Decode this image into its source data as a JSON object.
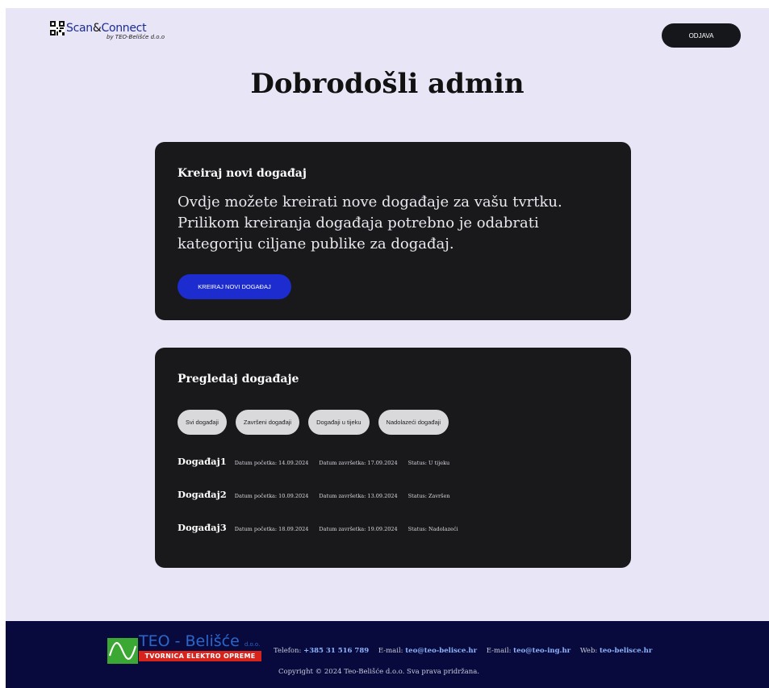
{
  "header": {
    "logo_text": "Scan",
    "logo_amp": "&",
    "logo_text2": "Connect",
    "logo_sub": "by TEO-Belišće d.o.o",
    "logout_label": "ODJAVA"
  },
  "title": "Dobrodošli admin",
  "create_card": {
    "title": "Kreiraj novi događaj",
    "description": "Ovdje možete kreirati nove događaje za vašu tvrtku. Prilikom kreiranja događaja potrebno je odabrati kategoriju ciljane publike za događaj.",
    "button_label": "KREIRAJ NOVI DOGAĐAJ"
  },
  "list_card": {
    "title": "Pregledaj događaje",
    "filters": [
      "Svi događaji",
      "Završeni događaji",
      "Događaji u tijeku",
      "Nadolazeći događaji"
    ],
    "events": [
      {
        "name": "Događaj1",
        "start": "Datum početka: 14.09.2024",
        "end": "Datum završetka: 17.09.2024",
        "status": "Status: U tijeku"
      },
      {
        "name": "Događaj2",
        "start": "Datum početka: 10.09.2024",
        "end": "Datum završetka: 13.09.2024",
        "status": "Status: Završen"
      },
      {
        "name": "Događaj3",
        "start": "Datum početka: 18.09.2024",
        "end": "Datum završetka: 19.09.2024",
        "status": "Status: Nadolazeći"
      }
    ]
  },
  "footer": {
    "brand": "TEO - Belišće",
    "brand_suffix": "d.o.o.",
    "tagline": "TVORNICA ELEKTRO OPREME",
    "phone_label": "Telefon:",
    "phone": "+385 31 516 789",
    "email1_label": "E-mail:",
    "email1": "teo@teo-belisce.hr",
    "email2_label": "E-mail:",
    "email2": "teo@teo-ing.hr",
    "web_label": "Web:",
    "web": "teo-belisce.hr",
    "copyright": "Copyright © 2024 Teo-Belišće d.o.o. Sva prava pridržana."
  },
  "colors": {
    "background": "#e8e6f6",
    "card": "#19191c",
    "primary_button": "#1c2ccf",
    "footer": "#080a3d",
    "link": "#8fb5ff"
  }
}
